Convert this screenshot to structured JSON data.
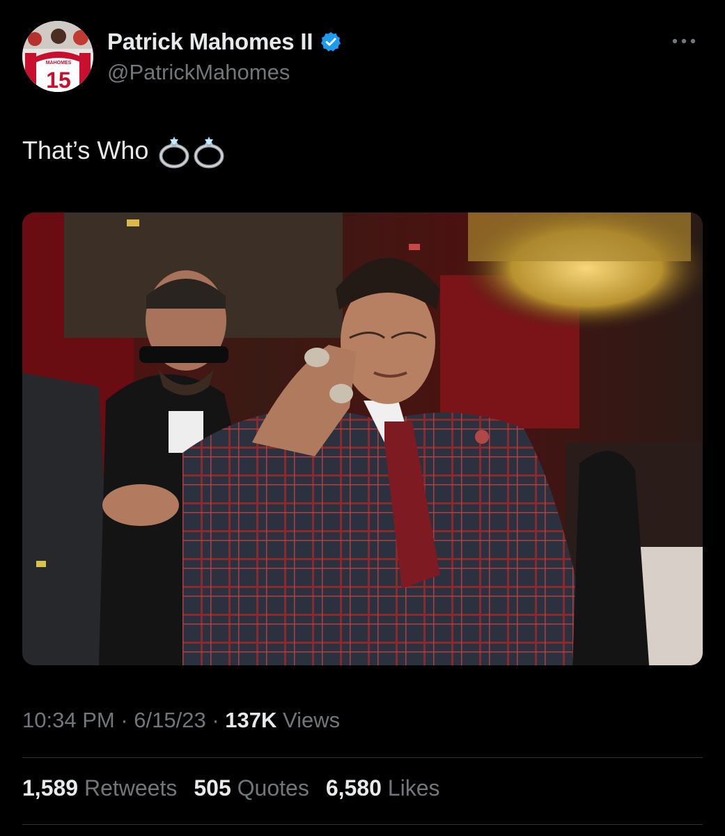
{
  "author": {
    "display_name": "Patrick Mahomes II",
    "handle": "@PatrickMahomes",
    "verified": true,
    "avatar_jersey_name": "MAHOMES",
    "avatar_jersey_number": "15"
  },
  "tweet": {
    "text": "That’s Who",
    "emojis": [
      "ring-emoji",
      "ring-emoji"
    ]
  },
  "media": {
    "type": "photo"
  },
  "meta": {
    "time": "10:34 PM",
    "separator": " · ",
    "date": "6/15/23",
    "views_count": "137K",
    "views_label": "Views"
  },
  "stats": [
    {
      "count": "1,589",
      "label": "Retweets"
    },
    {
      "count": "505",
      "label": "Quotes"
    },
    {
      "count": "6,580",
      "label": "Likes"
    }
  ],
  "colors": {
    "background": "#000000",
    "primary_text": "#e7e9ea",
    "secondary_text": "#71767b",
    "verified_blue": "#1d9bf0",
    "divider": "#2f3336"
  },
  "icons": {
    "verified": "verified-badge-icon",
    "more": "more-options-icon"
  }
}
